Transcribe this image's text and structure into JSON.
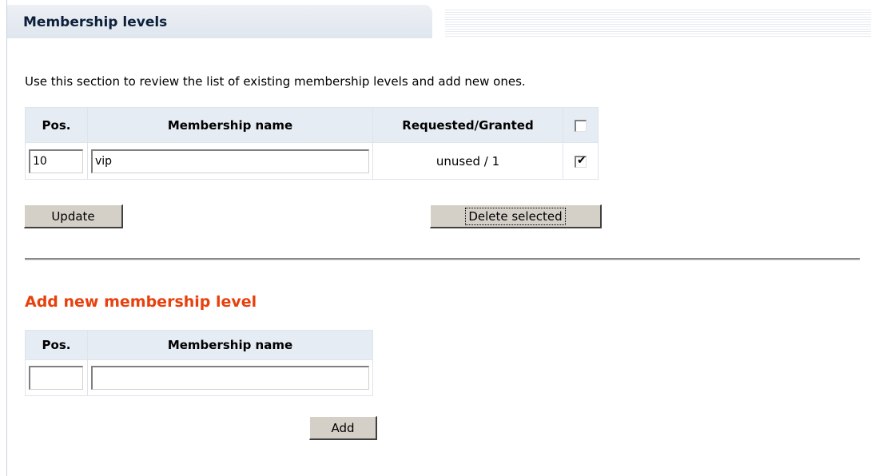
{
  "header": {
    "title": "Membership levels"
  },
  "intro": "Use this section to review the list of existing membership levels and add new ones.",
  "levels_table": {
    "columns": {
      "pos": "Pos.",
      "name": "Membership name",
      "requested_granted": "Requested/Granted"
    },
    "select_all_checked": false,
    "rows": [
      {
        "pos": "10",
        "name": "vip",
        "requested_granted": "unused / 1",
        "selected": true
      }
    ]
  },
  "buttons": {
    "update": "Update",
    "delete_selected": "Delete selected",
    "add": "Add"
  },
  "add_section": {
    "title": "Add new membership level",
    "columns": {
      "pos": "Pos.",
      "name": "Membership name"
    },
    "pos_value": "",
    "name_value": ""
  }
}
